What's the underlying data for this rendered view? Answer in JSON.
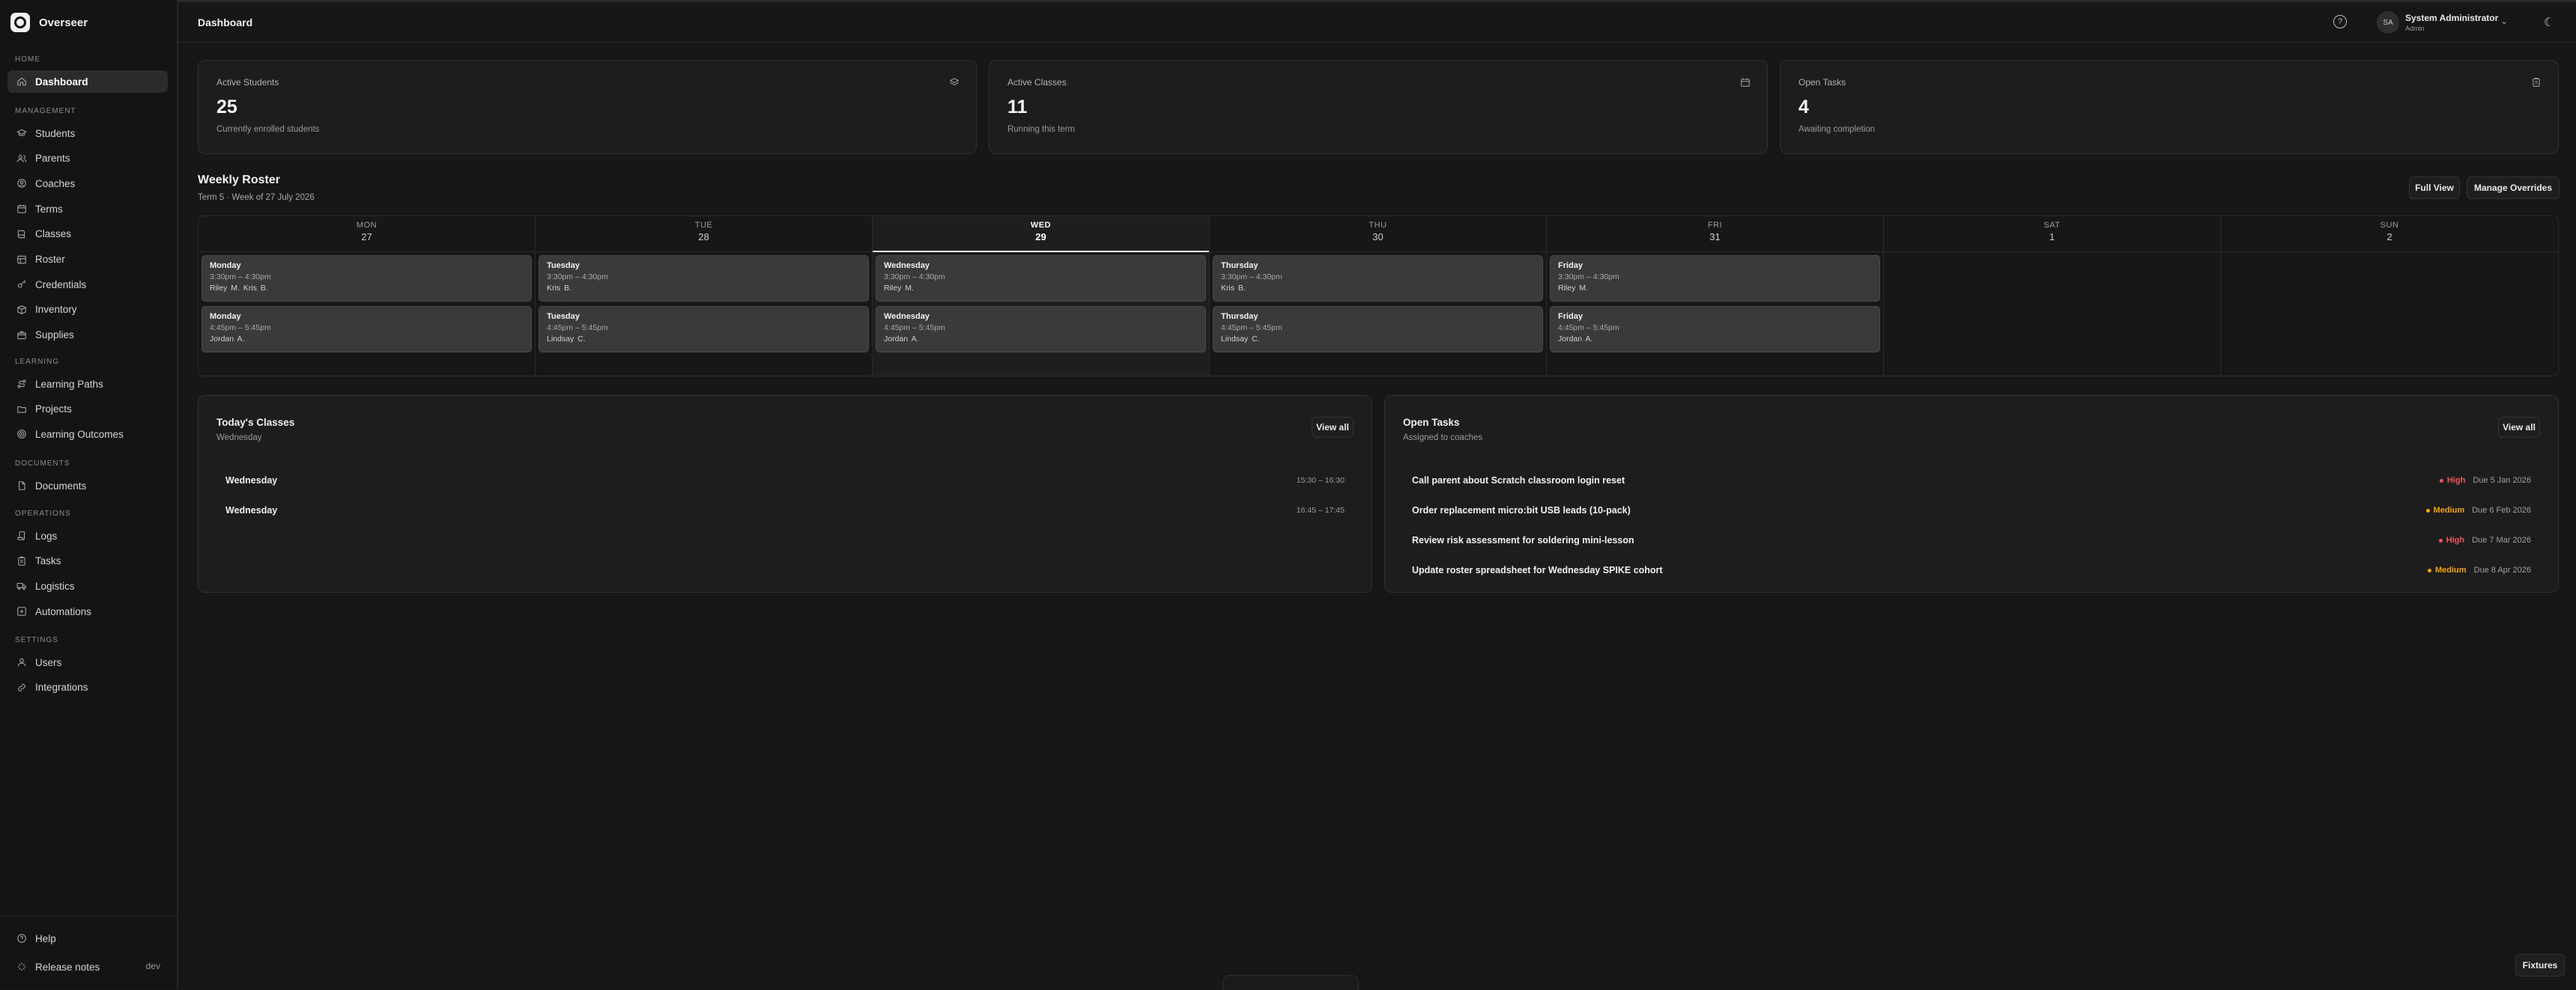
{
  "app": {
    "name": "Overseer"
  },
  "sidebar": {
    "sections": [
      {
        "label": "Home",
        "items": [
          {
            "label": "Dashboard",
            "icon": "home-icon",
            "active": true
          }
        ]
      },
      {
        "label": "Management",
        "items": [
          {
            "label": "Students",
            "icon": "graduation-cap-icon"
          },
          {
            "label": "Parents",
            "icon": "users-icon"
          },
          {
            "label": "Coaches",
            "icon": "user-circle-icon"
          },
          {
            "label": "Terms",
            "icon": "calendar-icon"
          },
          {
            "label": "Classes",
            "icon": "book-icon"
          },
          {
            "label": "Roster",
            "icon": "table-icon"
          },
          {
            "label": "Credentials",
            "icon": "key-icon"
          },
          {
            "label": "Inventory",
            "icon": "box-icon"
          },
          {
            "label": "Supplies",
            "icon": "package-icon"
          }
        ]
      },
      {
        "label": "Learning",
        "items": [
          {
            "label": "Learning Paths",
            "icon": "route-icon"
          },
          {
            "label": "Projects",
            "icon": "folder-icon"
          },
          {
            "label": "Learning Outcomes",
            "icon": "target-icon"
          }
        ]
      },
      {
        "label": "Documents",
        "items": [
          {
            "label": "Documents",
            "icon": "file-icon"
          }
        ]
      },
      {
        "label": "Operations",
        "items": [
          {
            "label": "Logs",
            "icon": "scroll-icon"
          },
          {
            "label": "Tasks",
            "icon": "clipboard-icon"
          },
          {
            "label": "Logistics",
            "icon": "truck-icon"
          },
          {
            "label": "Automations",
            "icon": "zap-icon"
          }
        ]
      },
      {
        "label": "Settings",
        "items": [
          {
            "label": "Users",
            "icon": "user-icon"
          },
          {
            "label": "Integrations",
            "icon": "link-icon"
          }
        ]
      }
    ],
    "footer": {
      "help": "Help",
      "release_notes": "Release notes",
      "env": "dev"
    }
  },
  "header": {
    "title": "Dashboard",
    "user": {
      "initials": "SA",
      "name": "System Administrator",
      "role": "Admin"
    }
  },
  "stats": [
    {
      "title": "Active Students",
      "value": "25",
      "subtitle": "Currently enrolled students",
      "icon": "layers-icon"
    },
    {
      "title": "Active Classes",
      "value": "11",
      "subtitle": "Running this term",
      "icon": "calendar-icon"
    },
    {
      "title": "Open Tasks",
      "value": "4",
      "subtitle": "Awaiting completion",
      "icon": "clipboard-icon"
    }
  ],
  "roster": {
    "title": "Weekly Roster",
    "subtitle": "Term 5 · Week of 27 July 2026",
    "full_view": "Full View",
    "manage_overrides": "Manage Overrides",
    "days": [
      {
        "name": "MON",
        "num": "27",
        "today": false,
        "classes": [
          {
            "day": "Monday",
            "time": "3:30pm – 4:30pm",
            "coaches": "Riley M.   Kris B."
          },
          {
            "day": "Monday",
            "time": "4:45pm – 5:45pm",
            "coaches": "Jordan A."
          }
        ]
      },
      {
        "name": "TUE",
        "num": "28",
        "today": false,
        "classes": [
          {
            "day": "Tuesday",
            "time": "3:30pm – 4:30pm",
            "coaches": "Kris B."
          },
          {
            "day": "Tuesday",
            "time": "4:45pm – 5:45pm",
            "coaches": "Lindsay C."
          }
        ]
      },
      {
        "name": "WED",
        "num": "29",
        "today": true,
        "classes": [
          {
            "day": "Wednesday",
            "time": "3:30pm – 4:30pm",
            "coaches": "Riley M."
          },
          {
            "day": "Wednesday",
            "time": "4:45pm – 5:45pm",
            "coaches": "Jordan A."
          }
        ]
      },
      {
        "name": "THU",
        "num": "30",
        "today": false,
        "classes": [
          {
            "day": "Thursday",
            "time": "3:30pm – 4:30pm",
            "coaches": "Kris B."
          },
          {
            "day": "Thursday",
            "time": "4:45pm – 5:45pm",
            "coaches": "Lindsay C."
          }
        ]
      },
      {
        "name": "FRI",
        "num": "31",
        "today": false,
        "classes": [
          {
            "day": "Friday",
            "time": "3:30pm – 4:30pm",
            "coaches": "Riley M."
          },
          {
            "day": "Friday",
            "time": "4:45pm – 5:45pm",
            "coaches": "Jordan A."
          }
        ]
      },
      {
        "name": "SAT",
        "num": "1",
        "today": false,
        "classes": []
      },
      {
        "name": "SUN",
        "num": "2",
        "today": false,
        "classes": []
      }
    ]
  },
  "today_classes": {
    "title": "Today's Classes",
    "subtitle": "Wednesday",
    "view_all": "View all",
    "items": [
      {
        "name": "Wednesday",
        "time": "15:30 – 16:30"
      },
      {
        "name": "Wednesday",
        "time": "16:45 – 17:45"
      }
    ]
  },
  "open_tasks": {
    "title": "Open Tasks",
    "subtitle": "Assigned to coaches",
    "view_all": "View all",
    "items": [
      {
        "name": "Call parent about Scratch classroom login reset",
        "priority": "High",
        "due": "Due 5 Jan 2026"
      },
      {
        "name": "Order replacement micro:bit USB leads (10-pack)",
        "priority": "Medium",
        "due": "Due 6 Feb 2026"
      },
      {
        "name": "Review risk assessment for soldering mini-lesson",
        "priority": "High",
        "due": "Due 7 Mar 2026"
      },
      {
        "name": "Update roster spreadsheet for Wednesday SPIKE cohort",
        "priority": "Medium",
        "due": "Due 8 Apr 2026"
      }
    ]
  },
  "colors": {
    "high": "#f0575b",
    "medium": "#f2a417"
  },
  "footer": {
    "fixtures": "Fixtures"
  }
}
